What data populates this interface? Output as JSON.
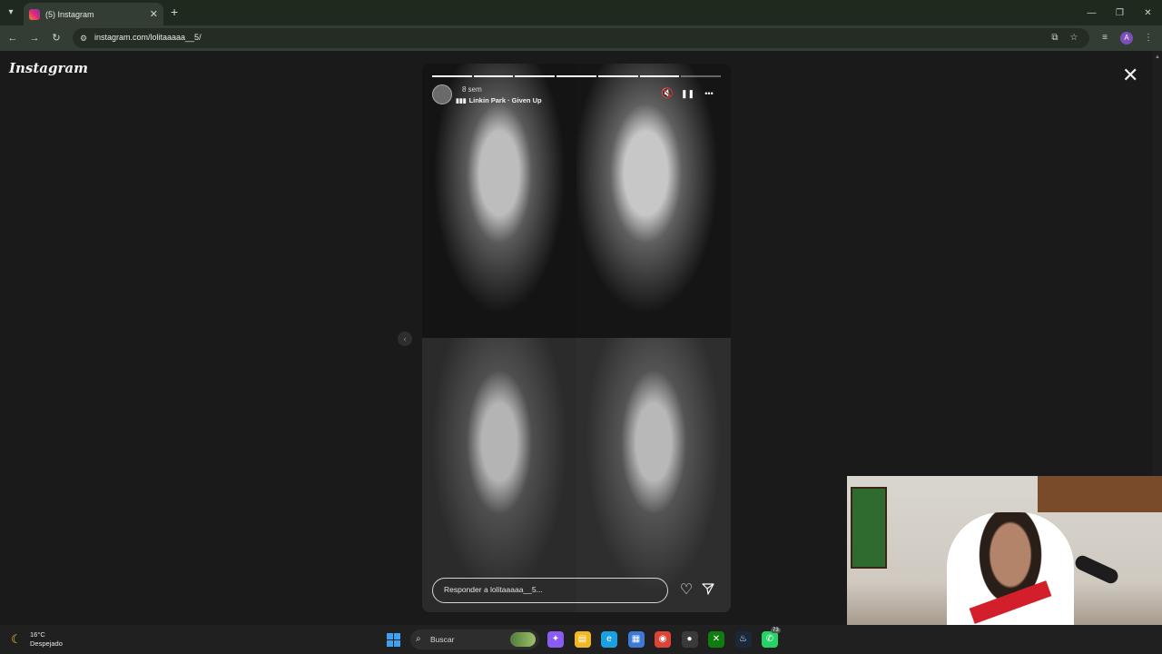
{
  "browser": {
    "tab_title": "(5) Instagram",
    "tab_close": "✕",
    "new_tab": "+",
    "url": "instagram.com/lolitaaaaa__5/",
    "profile_initial": "A",
    "icons": {
      "tab_list": "chevron-down-icon",
      "back": "back-arrow-icon",
      "forward": "forward-arrow-icon",
      "reload": "reload-icon",
      "site_info": "site-info-icon",
      "install": "install-app-icon",
      "bookmark": "star-icon",
      "media": "media-controls-icon",
      "menu": "kebab-menu-icon"
    },
    "window": {
      "minimize": "—",
      "maximize": "❐",
      "close": "✕"
    }
  },
  "page": {
    "logo": "Instagram",
    "close_label": "✕",
    "prev_label": "‹"
  },
  "story": {
    "time_ago": "8 sem",
    "music": "Linkin Park · Given Up",
    "music_icon": "equalizer-icon",
    "progress_total": 7,
    "progress_done": 6,
    "reply_placeholder": "Responder a lolitaaaaa__5...",
    "controls": {
      "mute": "🔇",
      "pause": "❚❚",
      "more": "•••"
    },
    "like_icon": "heart-icon",
    "share_icon": "paper-plane-icon"
  },
  "taskbar": {
    "weather_temp": "16°C",
    "weather_desc": "Despejado",
    "search_label": "Buscar",
    "apps": [
      {
        "name": "copilot-icon",
        "color": "#8a5cf6"
      },
      {
        "name": "file-explorer-icon",
        "color": "#f2b81f"
      },
      {
        "name": "edge-icon",
        "color": "#1aa0e0"
      },
      {
        "name": "store-icon",
        "color": "#3c7ad6"
      },
      {
        "name": "chrome-icon",
        "color": "#db4437"
      },
      {
        "name": "obs-icon",
        "color": "#3a3a3a"
      },
      {
        "name": "xbox-icon",
        "color": "#107c10"
      },
      {
        "name": "steam-icon",
        "color": "#1b2838"
      },
      {
        "name": "whatsapp-icon",
        "color": "#25d366"
      }
    ],
    "whatsapp_badge": "73"
  }
}
